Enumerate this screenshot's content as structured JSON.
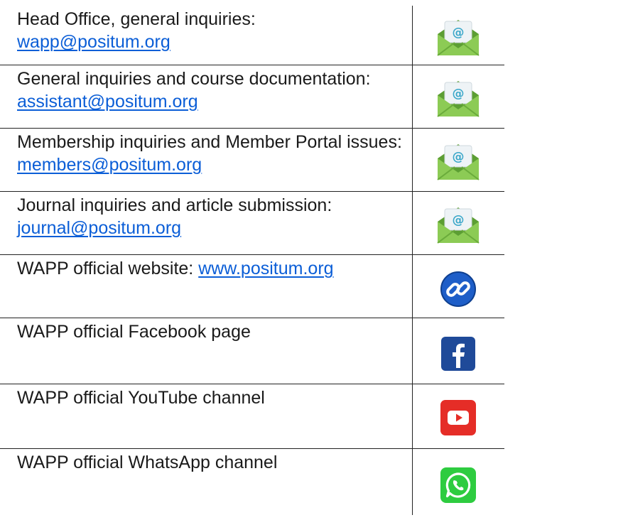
{
  "rows": [
    {
      "label": "Head Office, general inquiries:",
      "link": "wapp@positum.org",
      "icon": "email-envelope-icon"
    },
    {
      "label": "General inquiries and course documentation:",
      "link": "assistant@positum.org",
      "icon": "email-envelope-icon"
    },
    {
      "label": "Membership inquiries and Member Portal issues:",
      "link": "members@positum.org",
      "icon": "email-envelope-icon"
    },
    {
      "label": "Journal inquiries and article submission:",
      "link": "journal@positum.org",
      "icon": "email-envelope-icon"
    },
    {
      "label": "WAPP official website: ",
      "link": "www.positum.org",
      "icon": "chain-link-icon"
    },
    {
      "label": "WAPP official Facebook page",
      "icon": "facebook-icon"
    },
    {
      "label": "WAPP official YouTube channel",
      "icon": "youtube-icon"
    },
    {
      "label": "WAPP official WhatsApp channel",
      "icon": "whatsapp-icon"
    }
  ],
  "colors": {
    "link": "#0b5ed7",
    "envelope_green": "#7cc24f",
    "link_icon_blue": "#1e5ec8",
    "facebook_blue": "#1f4a99",
    "youtube_red": "#e52d27",
    "whatsapp_green": "#2ecc40"
  }
}
